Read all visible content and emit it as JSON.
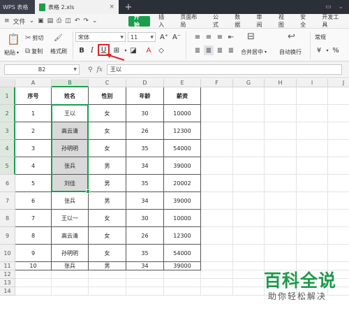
{
  "titlebar": {
    "app_tab": "WPS 表格",
    "doc_tab": "表格 2.xls",
    "doc_close": "×",
    "new_tab": "+",
    "icons": [
      "monitor-icon",
      "chevron-down-icon",
      "minimize-icon",
      "maximize-icon"
    ]
  },
  "menubar": {
    "file_menu": "文件",
    "tabs": [
      {
        "label": "开始",
        "active": true
      },
      {
        "label": "插入",
        "active": false
      },
      {
        "label": "页面布局",
        "active": false
      },
      {
        "label": "公式",
        "active": false
      },
      {
        "label": "数据",
        "active": false
      },
      {
        "label": "审阅",
        "active": false
      },
      {
        "label": "视图",
        "active": false
      },
      {
        "label": "安全",
        "active": false
      },
      {
        "label": "开发工具",
        "active": false
      }
    ]
  },
  "ribbon": {
    "paste": "粘贴",
    "cut": "剪切",
    "copy": "复制",
    "format_painter": "格式刷",
    "font_name": "宋体",
    "font_size": "11",
    "bold": "B",
    "italic": "I",
    "underline": "U",
    "merge_center": "合并居中",
    "wrap_text": "自动换行",
    "number_format": "常规",
    "currency": "¥",
    "percent": "%",
    "accent_color": "#1c9d4e",
    "highlight_color": "#e0232a"
  },
  "formulabar": {
    "cell_ref": "B2",
    "fx": "fx",
    "value": "王以"
  },
  "sheet": {
    "columns": [
      "A",
      "B",
      "C",
      "D",
      "E",
      "F",
      "G",
      "H",
      "I",
      "J"
    ],
    "rows": [
      "1",
      "2",
      "3",
      "4",
      "5",
      "6",
      "7",
      "8",
      "9",
      "10",
      "11",
      "12",
      "13",
      "14"
    ],
    "headers": [
      "序号",
      "姓名",
      "性别",
      "年龄",
      "薪资"
    ],
    "data": [
      [
        "1",
        "王以",
        "女",
        "30",
        "10000"
      ],
      [
        "2",
        "高云清",
        "女",
        "26",
        "12300"
      ],
      [
        "3",
        "孙明明",
        "女",
        "35",
        "54000"
      ],
      [
        "4",
        "张兵",
        "男",
        "34",
        "39000"
      ],
      [
        "5",
        "刘佳",
        "男",
        "35",
        "20002"
      ],
      [
        "6",
        "张兵",
        "男",
        "34",
        "39000"
      ],
      [
        "7",
        "王以一",
        "女",
        "30",
        "10000"
      ],
      [
        "8",
        "高云清",
        "女",
        "26",
        "12300"
      ],
      [
        "9",
        "孙明明",
        "女",
        "35",
        "54000"
      ],
      [
        "10",
        "张兵",
        "男",
        "34",
        "39000"
      ]
    ]
  },
  "watermark": {
    "main": "百科全说",
    "sub": "助你轻松解决"
  }
}
